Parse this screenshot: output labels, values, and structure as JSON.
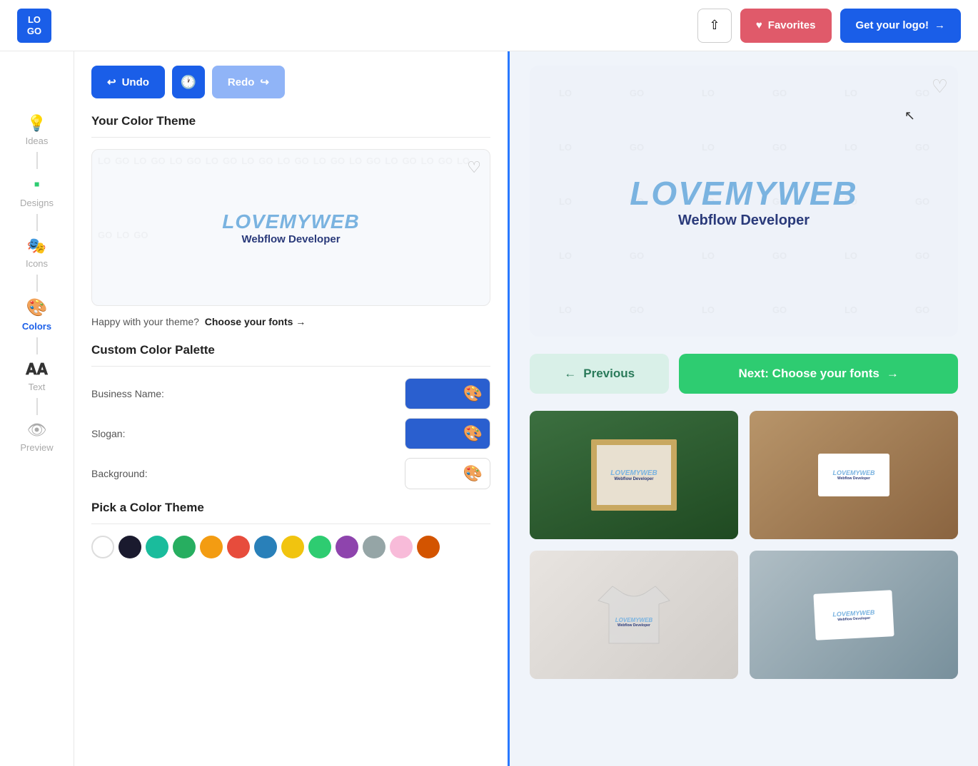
{
  "topbar": {
    "logo_text": "LO\nGO",
    "share_icon": "⇧",
    "favorites_icon": "♥",
    "favorites_label": "Favorites",
    "get_logo_label": "Get your logo!",
    "get_logo_arrow": "→"
  },
  "sidebar": {
    "items": [
      {
        "id": "ideas",
        "label": "Ideas",
        "icon": "💡",
        "active": false
      },
      {
        "id": "designs",
        "label": "Designs",
        "icon": "🟩",
        "active": false
      },
      {
        "id": "icons",
        "label": "Icons",
        "icon": "🎭",
        "active": false
      },
      {
        "id": "colors",
        "label": "Colors",
        "icon": "🎨",
        "active": true
      },
      {
        "id": "text",
        "label": "Text",
        "icon": "𝐀𝐀",
        "active": false
      },
      {
        "id": "preview",
        "label": "Preview",
        "icon": "👁",
        "active": false
      }
    ]
  },
  "left_panel": {
    "toolbar": {
      "undo_label": "Undo",
      "history_icon": "🕐",
      "redo_label": "Redo"
    },
    "color_theme": {
      "title": "Your Color Theme",
      "heart_icon": "♡",
      "logo_name": "LOVEMYWEB",
      "logo_slogan": "Webflow Developer",
      "choose_fonts_text": "Happy with your theme?",
      "choose_fonts_link": "Choose your fonts →"
    },
    "custom_palette": {
      "title": "Custom Color Palette",
      "business_name_label": "Business Name:",
      "slogan_label": "Slogan:",
      "background_label": "Background:",
      "color_icon": "🎨"
    },
    "pick_theme": {
      "title": "Pick a Color Theme",
      "swatches": [
        {
          "color": "#ffffff",
          "id": "white"
        },
        {
          "color": "#1a1a2e",
          "id": "dark-navy"
        },
        {
          "color": "#1abc9c",
          "id": "teal"
        },
        {
          "color": "#27ae60",
          "id": "green"
        },
        {
          "color": "#f39c12",
          "id": "orange"
        },
        {
          "color": "#e74c3c",
          "id": "red"
        },
        {
          "color": "#2980b9",
          "id": "blue"
        },
        {
          "color": "#f1c40f",
          "id": "yellow"
        },
        {
          "color": "#2ecc71",
          "id": "lime"
        },
        {
          "color": "#8e44ad",
          "id": "purple"
        },
        {
          "color": "#95a5a6",
          "id": "gray"
        },
        {
          "color": "#f8bbd9",
          "id": "pink"
        },
        {
          "color": "#d35400",
          "id": "dark-orange"
        }
      ]
    }
  },
  "right_panel": {
    "heart_icon": "♡",
    "logo_name": "LOVEMYWEB",
    "logo_slogan": "Webflow Developer",
    "prev_label": "Previous",
    "prev_arrow": "←",
    "next_label": "Next: Choose your fonts",
    "next_arrow": "→",
    "mockups": [
      {
        "id": "mockup-1",
        "type": "frame"
      },
      {
        "id": "mockup-2",
        "type": "card-hand"
      },
      {
        "id": "mockup-3",
        "type": "tshirt"
      },
      {
        "id": "mockup-4",
        "type": "card-table"
      }
    ],
    "mockup_logo_name": "LOVEMYWEB",
    "mockup_logo_slogan": "Webflow Developer"
  }
}
